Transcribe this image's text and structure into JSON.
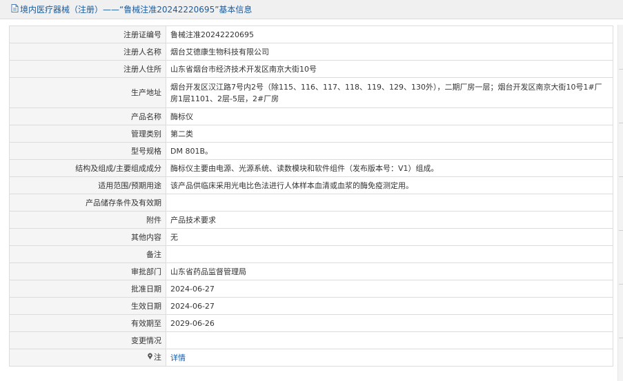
{
  "header": {
    "title": "境内医疗器械（注册）——“鲁械注准20242220695”基本信息"
  },
  "rows": [
    {
      "label": "注册证编号",
      "value": "鲁械注准20242220695"
    },
    {
      "label": "注册人名称",
      "value": "烟台艾德康生物科技有限公司"
    },
    {
      "label": "注册人住所",
      "value": "山东省烟台市经济技术开发区南京大街10号"
    },
    {
      "label": "生产地址",
      "value": "烟台开发区汉江路7号内2号（除115、116、117、118、119、129、130外），二期厂房一层；烟台开发区南京大街10号1#厂房1层1101、2层-5层，2#厂房"
    },
    {
      "label": "产品名称",
      "value": "酶标仪"
    },
    {
      "label": "管理类别",
      "value": "第二类"
    },
    {
      "label": "型号规格",
      "value": "DM 801B。"
    },
    {
      "label": "结构及组成/主要组成成分",
      "value": "酶标仪主要由电源、光源系统、读数模块和软件组件（发布版本号：V1）组成。"
    },
    {
      "label": "适用范围/预期用途",
      "value": "该产品供临床采用光电比色法进行人体样本血清或血浆的酶免疫测定用。"
    },
    {
      "label": "产品储存条件及有效期",
      "value": ""
    },
    {
      "label": "附件",
      "value": "产品技术要求"
    },
    {
      "label": "其他内容",
      "value": "无"
    },
    {
      "label": "备注",
      "value": ""
    },
    {
      "label": "审批部门",
      "value": "山东省药品监督管理局"
    },
    {
      "label": "批准日期",
      "value": "2024-06-27"
    },
    {
      "label": "生效日期",
      "value": "2024-06-27"
    },
    {
      "label": "有效期至",
      "value": "2029-06-26"
    },
    {
      "label": "变更情况",
      "value": ""
    }
  ],
  "note_row": {
    "label": "注",
    "link": "详情"
  },
  "icons": {
    "header": "document-icon",
    "note": "pin-icon"
  },
  "colors": {
    "header_text": "#1a5a9a",
    "link": "#1a5aa6",
    "label_bg": "#f5f5f5",
    "border": "#dcdcdc"
  }
}
